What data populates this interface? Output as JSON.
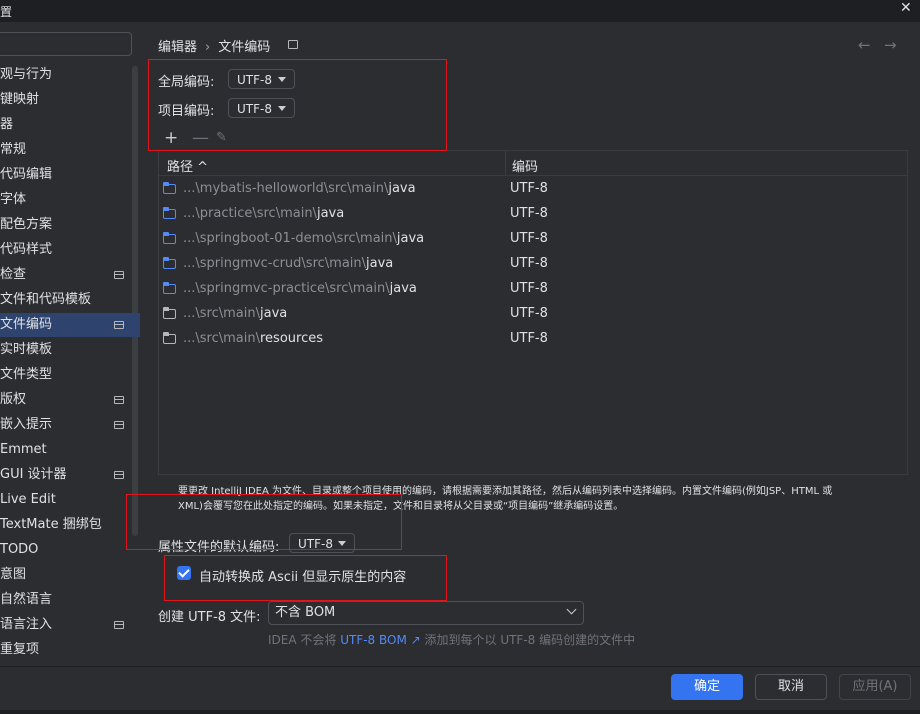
{
  "window": {
    "title": "置",
    "close_glyph": "✕"
  },
  "sidebar": {
    "items": [
      {
        "label": "观与行为",
        "doc": false
      },
      {
        "label": "键映射",
        "doc": false
      },
      {
        "label": "器",
        "doc": false
      },
      {
        "label": "常规",
        "doc": false
      },
      {
        "label": "代码编辑",
        "doc": false
      },
      {
        "label": "字体",
        "doc": false
      },
      {
        "label": "配色方案",
        "doc": false
      },
      {
        "label": "代码样式",
        "doc": false
      },
      {
        "label": "检查",
        "doc": true
      },
      {
        "label": "文件和代码模板",
        "doc": false
      },
      {
        "label": "文件编码",
        "doc": true,
        "selected": true
      },
      {
        "label": "实时模板",
        "doc": false
      },
      {
        "label": "文件类型",
        "doc": false
      },
      {
        "label": "版权",
        "doc": true
      },
      {
        "label": "嵌入提示",
        "doc": true
      },
      {
        "label": "Emmet",
        "doc": false
      },
      {
        "label": "GUI 设计器",
        "doc": true
      },
      {
        "label": "Live Edit",
        "doc": false
      },
      {
        "label": "TextMate 捆绑包",
        "doc": false
      },
      {
        "label": "TODO",
        "doc": false
      },
      {
        "label": "意图",
        "doc": false
      },
      {
        "label": "自然语言",
        "doc": false
      },
      {
        "label": "语言注入",
        "doc": true
      },
      {
        "label": "重复项",
        "doc": false
      }
    ]
  },
  "breadcrumb": {
    "parent": "编辑器",
    "separator": "›",
    "current": "文件编码"
  },
  "nav": {
    "back": "←",
    "forward": "→"
  },
  "global_encoding": {
    "label": "全局编码:",
    "value": "UTF-8"
  },
  "project_encoding": {
    "label": "项目编码:",
    "value": "UTF-8"
  },
  "toolbar": {
    "add": "+",
    "remove": "—",
    "edit": "✎"
  },
  "table": {
    "col_path": "路径 ^",
    "col_encoding": "编码",
    "rows": [
      {
        "prefix": "...\\mybatis-helloworld\\src\\main\\",
        "leaf": "java",
        "encoding": "UTF-8",
        "source": true
      },
      {
        "prefix": "...\\practice\\src\\main\\",
        "leaf": "java",
        "encoding": "UTF-8",
        "source": true
      },
      {
        "prefix": "...\\springboot-01-demo\\src\\main\\",
        "leaf": "java",
        "encoding": "UTF-8",
        "source": true
      },
      {
        "prefix": "...\\springmvc-crud\\src\\main\\",
        "leaf": "java",
        "encoding": "UTF-8",
        "source": true
      },
      {
        "prefix": "...\\springmvc-practice\\src\\main\\",
        "leaf": "java",
        "encoding": "UTF-8",
        "source": true
      },
      {
        "prefix": "...\\src\\main\\",
        "leaf": "java",
        "encoding": "UTF-8",
        "source": false
      },
      {
        "prefix": "...\\src\\main\\",
        "leaf": "resources",
        "encoding": "UTF-8",
        "source": false
      }
    ]
  },
  "description": {
    "line1": "要更改 IntelliJ IDEA 为文件、目录或整个项目使用的编码，请根据需要添加其路径，然后从编码列表中选择编码。内置文件编码(例如JSP、HTML 或",
    "line2": "XML)会覆写您在此处指定的编码。如果未指定，文件和目录将从父目录或“项目编码”继承编码设置。"
  },
  "properties_encoding": {
    "label": "属性文件的默认编码:",
    "value": "UTF-8"
  },
  "ascii_option": {
    "label": "自动转换成 Ascii 但显示原生的内容",
    "checked": true
  },
  "bom": {
    "label": "创建 UTF-8 文件:",
    "value": "不含 BOM"
  },
  "hint": {
    "before": "IDEA 不会将 ",
    "link": "UTF-8 BOM ↗",
    "after": " 添加到每个以 UTF-8 编码创建的文件中"
  },
  "buttons": {
    "ok": "确定",
    "cancel": "取消",
    "apply": "应用(A)"
  },
  "colors": {
    "accent": "#3574f0",
    "selection": "#2e436e",
    "annotation_red": "#e0161b",
    "background": "#2b2d30"
  }
}
